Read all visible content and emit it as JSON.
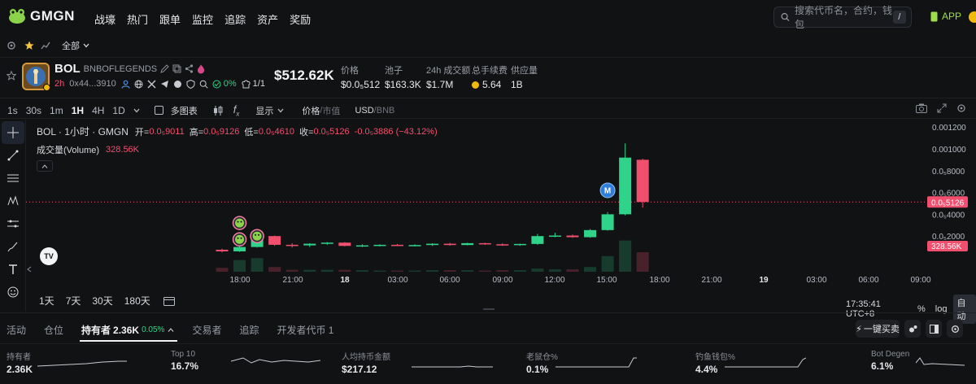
{
  "nav": {
    "logo": "GMGN",
    "items": [
      "战壕",
      "热门",
      "跟单",
      "监控",
      "追踪",
      "资产",
      "奖励"
    ],
    "search_placeholder": "搜索代币名，合约，钱包",
    "search_shortcut": "/",
    "app_label": "APP"
  },
  "subbar": {
    "filter_label": "全部"
  },
  "token": {
    "symbol": "BOL",
    "name": "BNBOFLEGENDS",
    "age": "2h",
    "address": "0x44...3910",
    "holder_pct": "0%",
    "ratio": "1/1",
    "market_cap": "$512.62K",
    "stats": [
      {
        "label": "价格",
        "value": "$0.0₅512"
      },
      {
        "label": "池子",
        "value": "$163.3K"
      },
      {
        "label": "24h 成交额",
        "value": "$1.7M"
      },
      {
        "label": "总手续费",
        "value": "5.64"
      },
      {
        "label": "供应量",
        "value": "1B"
      }
    ]
  },
  "toolbar": {
    "timeframes": [
      "1s",
      "30s",
      "1m",
      "1H",
      "4H",
      "1D"
    ],
    "active_timeframe": "1H",
    "multi_chart": "多图表",
    "display": "显示",
    "price_label": "价格",
    "mcap_label": "市值",
    "usd_label": "USD",
    "bnb_label": "BNB"
  },
  "chart_legend": {
    "title": "BOL · 1小时 · GMGN",
    "open_label": "开=",
    "open": "0.0₅9011",
    "high_label": "高=",
    "high": "0.0₅9126",
    "low_label": "低=",
    "low": "0.0₅4610",
    "close_label": "收=",
    "close": "0.0₅5126",
    "change": "-0.0₅3886 (−43.12%)",
    "volume_label": "成交量(Volume)",
    "volume": "328.56K"
  },
  "chart_data": {
    "type": "candlestick",
    "y_ticks": [
      "0.001200",
      "0.001000",
      "0.0₅8000",
      "0.0₅6000",
      "0.0₅4000",
      "0.0₅2000"
    ],
    "y_tick_values": [
      0.0012,
      0.001,
      0.0008,
      0.0006,
      0.0004,
      0.0002
    ],
    "x_ticks": [
      "18:00",
      "21:00",
      "18",
      "03:00",
      "06:00",
      "09:00",
      "12:00",
      "15:00",
      "18:00",
      "21:00",
      "19",
      "03:00",
      "06:00",
      "09:00"
    ],
    "last_price_label": "0.0₅5126",
    "last_volume_label": "328.56K",
    "candles": [
      {
        "o": 7.5e-05,
        "h": 8.5e-05,
        "l": 5e-05,
        "c": 6e-05,
        "v": 0.1
      },
      {
        "o": 6e-05,
        "h": 0.000115,
        "l": 5.5e-05,
        "c": 0.0001,
        "v": 0.3
      },
      {
        "o": 0.0001,
        "h": 0.00023,
        "l": 9.5e-05,
        "c": 0.00019,
        "v": 0.35
      },
      {
        "o": 0.0002,
        "h": 0.000205,
        "l": 0.00011,
        "c": 0.00012,
        "v": 0.12
      },
      {
        "o": 0.00012,
        "h": 0.000135,
        "l": 9.5e-05,
        "c": 0.000115,
        "v": 0.05
      },
      {
        "o": 0.000115,
        "h": 0.000135,
        "l": 0.0001,
        "c": 0.00013,
        "v": 0.05
      },
      {
        "o": 0.00013,
        "h": 0.000145,
        "l": 0.00012,
        "c": 0.00014,
        "v": 0.05
      },
      {
        "o": 0.00014,
        "h": 0.000145,
        "l": 0.000105,
        "c": 0.00011,
        "v": 0.05
      },
      {
        "o": 0.00011,
        "h": 0.000125,
        "l": 0.0001,
        "c": 0.000115,
        "v": 0.04
      },
      {
        "o": 0.000115,
        "h": 0.000125,
        "l": 0.000105,
        "c": 0.00012,
        "v": 0.03
      },
      {
        "o": 0.00012,
        "h": 0.000128,
        "l": 0.000108,
        "c": 0.000112,
        "v": 0.03
      },
      {
        "o": 0.000112,
        "h": 0.000125,
        "l": 0.000105,
        "c": 0.000118,
        "v": 0.03
      },
      {
        "o": 0.000118,
        "h": 0.000135,
        "l": 0.00011,
        "c": 0.00013,
        "v": 0.04
      },
      {
        "o": 0.00013,
        "h": 0.000138,
        "l": 0.000112,
        "c": 0.000118,
        "v": 0.04
      },
      {
        "o": 0.000118,
        "h": 0.00014,
        "l": 0.000115,
        "c": 0.000135,
        "v": 0.04
      },
      {
        "o": 0.000135,
        "h": 0.00014,
        "l": 0.00012,
        "c": 0.000125,
        "v": 0.03
      },
      {
        "o": 0.000125,
        "h": 0.000135,
        "l": 0.00011,
        "c": 0.00012,
        "v": 0.04
      },
      {
        "o": 0.00012,
        "h": 0.00013,
        "l": 0.00011,
        "c": 0.000128,
        "v": 0.04
      },
      {
        "o": 0.000128,
        "h": 0.00022,
        "l": 0.00012,
        "c": 0.0002,
        "v": 0.08
      },
      {
        "o": 0.0002,
        "h": 0.00023,
        "l": 0.00019,
        "c": 0.000205,
        "v": 0.06
      },
      {
        "o": 0.000205,
        "h": 0.000215,
        "l": 0.000185,
        "c": 0.00019,
        "v": 0.06
      },
      {
        "o": 0.00019,
        "h": 0.000265,
        "l": 0.000185,
        "c": 0.000255,
        "v": 0.12
      },
      {
        "o": 0.000255,
        "h": 0.00042,
        "l": 0.00025,
        "c": 0.0004,
        "v": 0.4
      },
      {
        "o": 0.0004,
        "h": 0.00105,
        "l": 0.00039,
        "c": 0.00092,
        "v": 0.8
      },
      {
        "o": 0.0009,
        "h": 0.00091,
        "l": 0.000461,
        "c": 0.000513,
        "v": 0.5
      }
    ],
    "markers": [
      {
        "index": 1,
        "price": 0.00017,
        "type": "buy"
      },
      {
        "index": 1,
        "price": 0.00032,
        "type": "buy"
      },
      {
        "index": 2,
        "price": 0.0002,
        "type": "buy"
      },
      {
        "index": 22,
        "price": 0.00056,
        "type": "M"
      }
    ]
  },
  "range_buttons": [
    "1天",
    "7天",
    "30天",
    "180天"
  ],
  "chart_footer": {
    "time": "17:35:41 UTC+8",
    "pct": "%",
    "log": "log",
    "auto": "自动"
  },
  "tabs": {
    "items": [
      "活动",
      "仓位"
    ],
    "holders_label": "持有者",
    "holders_value": "2.36K",
    "holders_pct": "0.05%",
    "rest": [
      "交易者",
      "追踪",
      "开发者代币 1"
    ],
    "quick_buy": "一键买卖"
  },
  "metrics": [
    {
      "label": "持有者",
      "value": "2.36K"
    },
    {
      "label": "Top 10",
      "value": "16.7%"
    },
    {
      "label": "人均持币金额",
      "value": "$217.12"
    },
    {
      "label": "老鼠仓%",
      "value": "0.1%"
    },
    {
      "label": "钓鱼钱包%",
      "value": "4.4%"
    },
    {
      "label": "Bot Degen",
      "value": "6.1%"
    }
  ],
  "colors": {
    "up": "#2fd38a",
    "down": "#f0506e",
    "accent": "#9be04a",
    "bg": "#111214"
  }
}
